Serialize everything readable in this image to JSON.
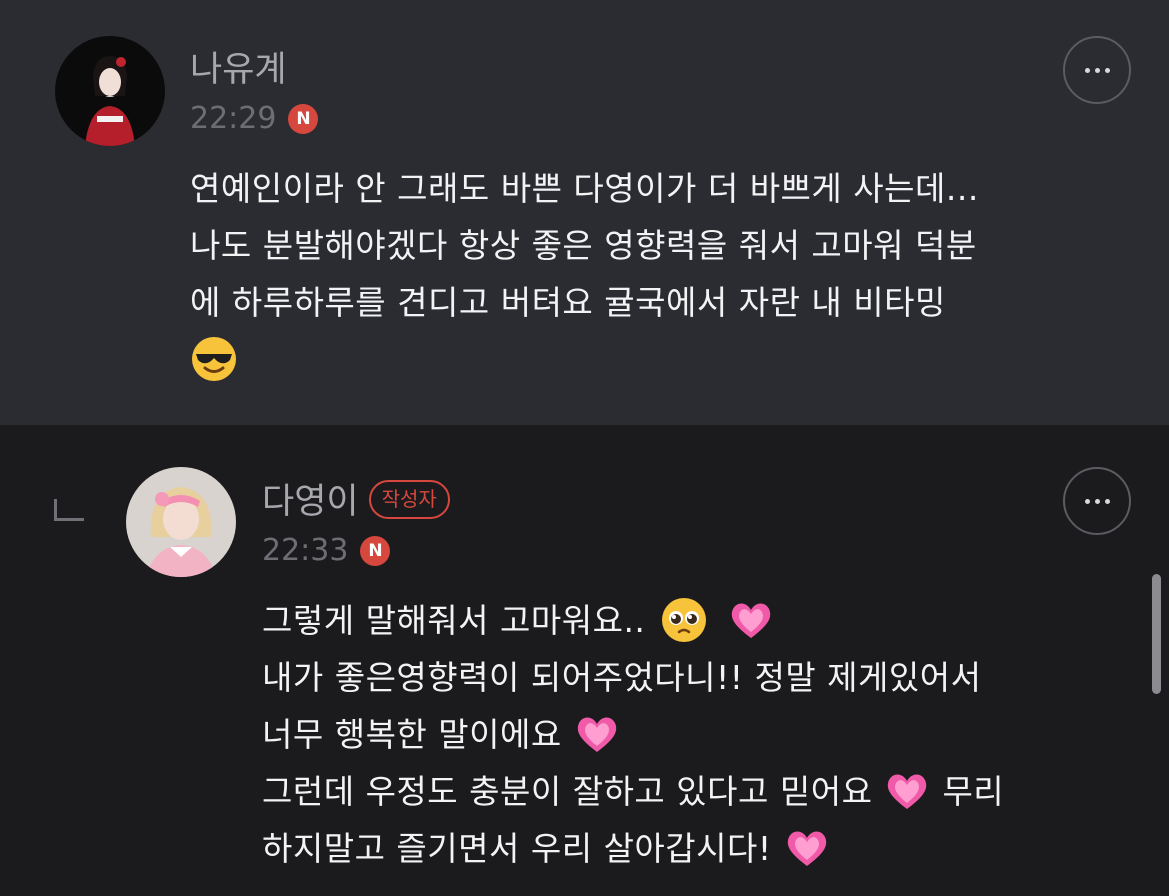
{
  "comments": [
    {
      "author": "나유계",
      "time": "22:29",
      "new_badge": "N",
      "lines": [
        "연예인이라 안 그래도 바쁜 다영이가 더 바쁘게 사는데...",
        "나도 분발해야겠다 항상 좋은 영향력을 줘서 고마워 덕분",
        "에 하루하루를 견디고 버텨요 귤국에서 자란 내 비타밍"
      ],
      "emoji_end": "smiling-face-with-sunglasses"
    },
    {
      "author": "다영이",
      "author_badge": "작성자",
      "time": "22:33",
      "new_badge": "N",
      "lines": [
        "그렇게 말해줘서 고마워요..",
        "내가 좋은영향력이 되어주었다니!! 정말 제게있어서",
        "너무 행복한 말이에요",
        "그런데 우정도 충분이 잘하고 있다고 믿어요",
        "무리",
        "하지말고 즐기면서 우리 살아갑시다!"
      ]
    }
  ],
  "colors": {
    "top_bg": "#2a2c31",
    "reply_bg": "#1b1b1d",
    "accent_red": "#d6473e",
    "heart_pink": "#f05aa8"
  }
}
